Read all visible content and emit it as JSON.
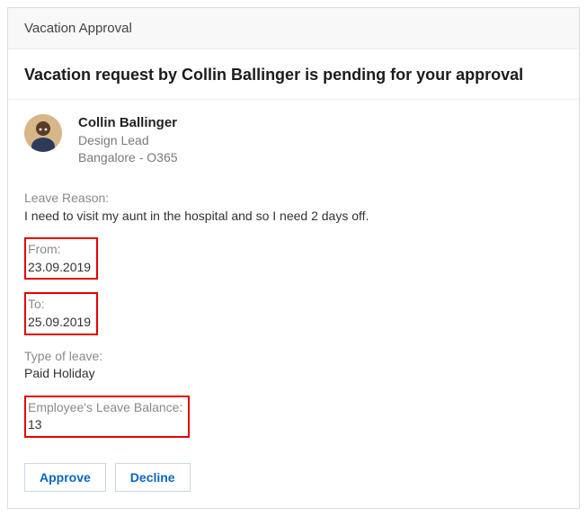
{
  "header": {
    "title": "Vacation Approval"
  },
  "main": {
    "headline": "Vacation request by Collin Ballinger is pending for your approval",
    "profile": {
      "name": "Collin Ballinger",
      "role": "Design Lead",
      "location": "Bangalore - O365"
    },
    "fields": {
      "reason": {
        "label": "Leave Reason:",
        "value": "I need to visit my aunt in the hospital and so I need 2 days off."
      },
      "from": {
        "label": "From:",
        "value": "23.09.2019",
        "highlight": true
      },
      "to": {
        "label": "To:",
        "value": "25.09.2019",
        "highlight": true
      },
      "type": {
        "label": "Type of leave:",
        "value": "Paid Holiday"
      },
      "balance": {
        "label": "Employee's Leave Balance:",
        "value": "13",
        "highlight": true
      }
    }
  },
  "actions": {
    "approve": "Approve",
    "decline": "Decline"
  }
}
